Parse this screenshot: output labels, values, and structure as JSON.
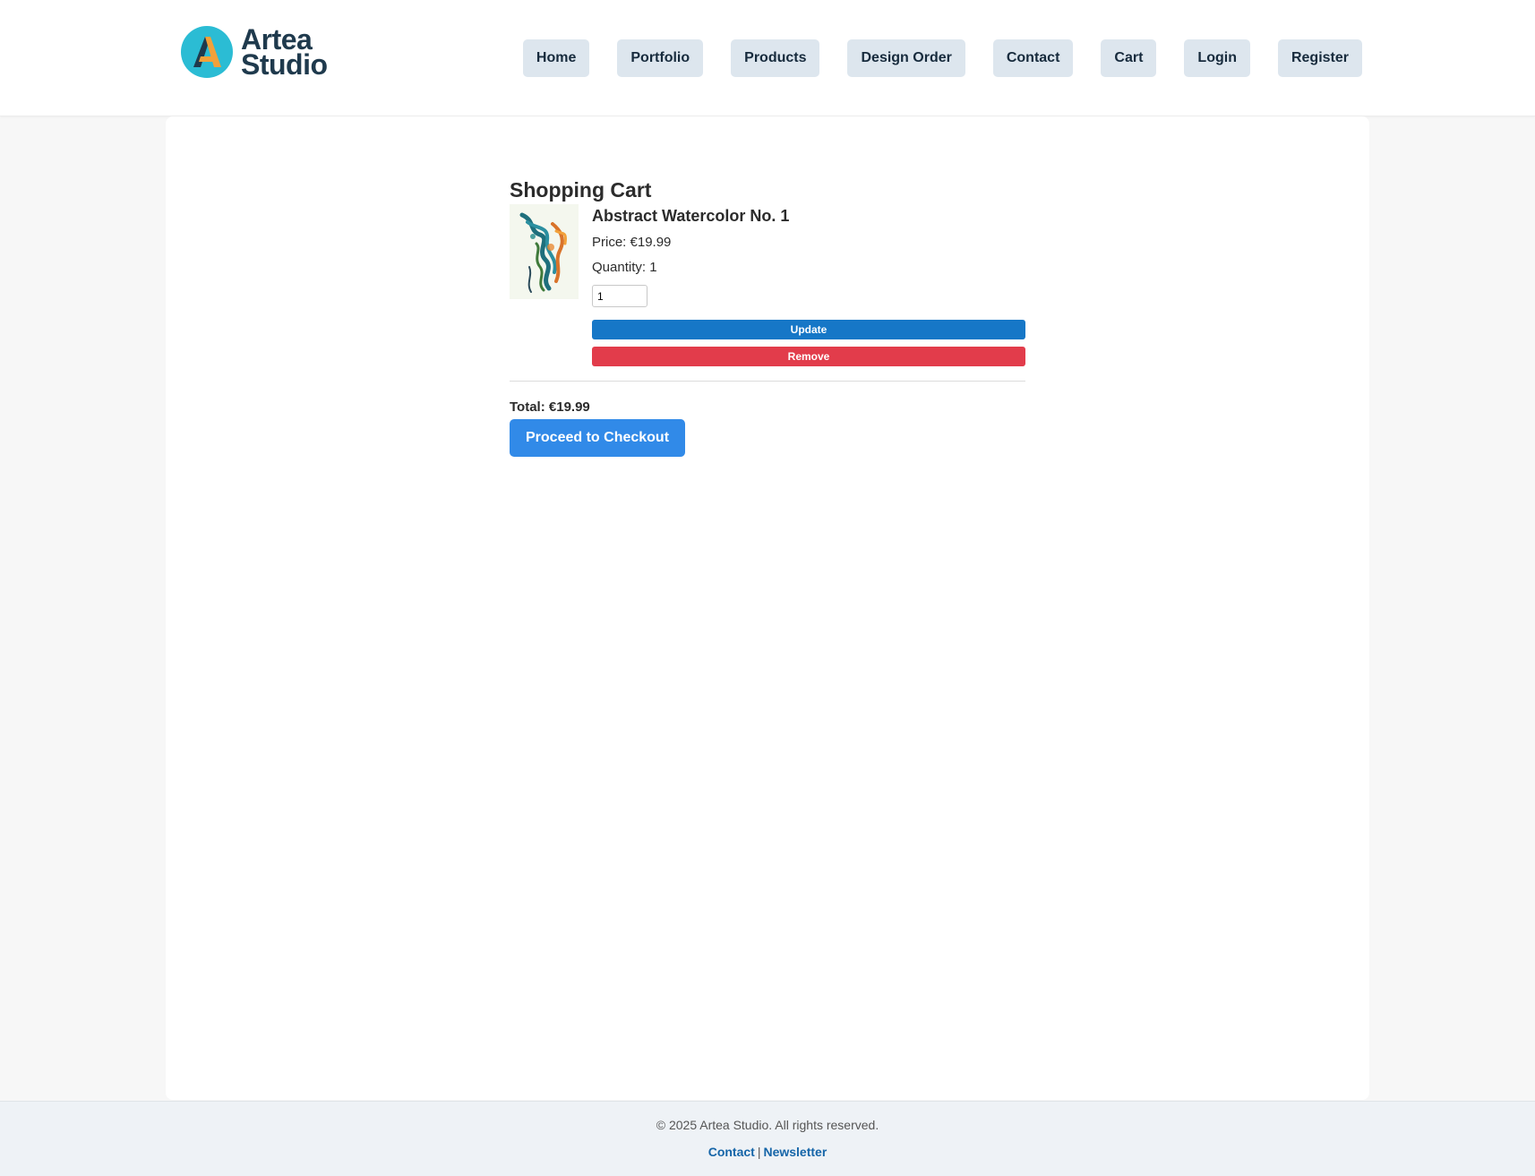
{
  "brand": {
    "line1": "Artea",
    "line2": "Studio",
    "colors": {
      "circle": "#2bbcd4",
      "a_dark": "#1f3a4d",
      "a_orange": "#f2a13a",
      "text": "#1f3a4d"
    }
  },
  "nav": {
    "items": [
      {
        "label": "Home"
      },
      {
        "label": "Portfolio"
      },
      {
        "label": "Products"
      },
      {
        "label": "Design Order"
      },
      {
        "label": "Contact"
      },
      {
        "label": "Cart"
      },
      {
        "label": "Login"
      },
      {
        "label": "Register"
      }
    ]
  },
  "cart": {
    "title": "Shopping Cart",
    "items": [
      {
        "name": "Abstract Watercolor No. 1",
        "price_text": "Price: €19.99",
        "quantity_text": "Quantity: 1",
        "quantity_value": "1",
        "update_label": "Update",
        "remove_label": "Remove",
        "thumbnail_icon": "abstract-watercolor-thumbnail"
      }
    ],
    "total_text": "Total: €19.99",
    "checkout_label": "Proceed to Checkout"
  },
  "footer": {
    "copyright": "© 2025 Artea Studio. All rights reserved.",
    "links": [
      {
        "label": "Contact"
      },
      {
        "label": "Newsletter"
      }
    ],
    "separator": "|"
  },
  "colors": {
    "update_button": "#1677c7",
    "remove_button": "#e23c4b",
    "checkout_button": "#318ae8",
    "nav_button_bg": "#dde6ee",
    "footer_link": "#1565a8"
  }
}
